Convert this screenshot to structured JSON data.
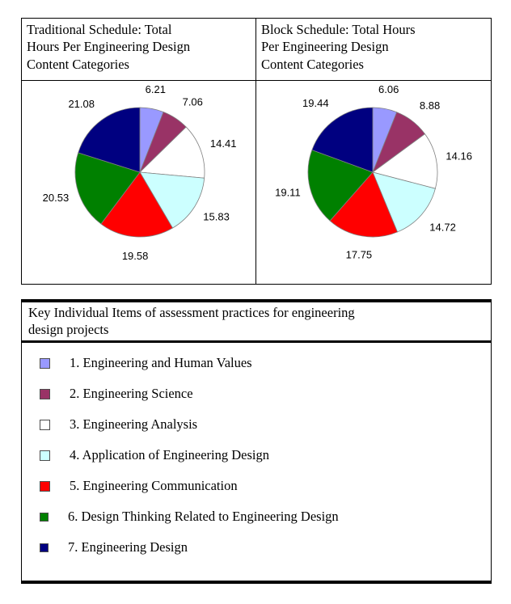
{
  "panels": [
    {
      "title_lines": [
        "Traditional Schedule: Total",
        "Hours Per Engineering Design",
        "Content Categories"
      ],
      "title_full": "Traditional Schedule: Total Hours Per Engineering Design Content Categories"
    },
    {
      "title_lines": [
        "Block Schedule: Total Hours",
        "Per Engineering Design",
        "Content Categories"
      ],
      "title_full": "Block Schedule: Total Hours Per Engineering Design Content Categories"
    }
  ],
  "legend": {
    "title_lines": [
      "Key Individual Items of assessment practices for engineering",
      "design projects"
    ],
    "title_full": "Key Individual Items of assessment practices for engineering design projects",
    "items": [
      {
        "label": "1. Engineering and Human Values",
        "color": "#9999FF"
      },
      {
        "label": "2. Engineering Science",
        "color": "#993366"
      },
      {
        "label": "3. Engineering Analysis",
        "color": "#FFFFFF"
      },
      {
        "label": "4. Application of Engineering Design",
        "color": "#CCFFFF"
      },
      {
        "label": "5. Engineering Communication",
        "color": "#FF0000"
      },
      {
        "label": "6. Design Thinking Related to Engineering Design",
        "color": "#008000"
      },
      {
        "label": "7. Engineering Design",
        "color": "#000080"
      }
    ]
  },
  "chart_data": [
    {
      "type": "pie",
      "title": "Traditional Schedule: Total Hours Per Engineering Design Content Categories",
      "categories": [
        "1. Engineering and Human Values",
        "2. Engineering Science",
        "3. Engineering Analysis",
        "4. Application of Engineering Design",
        "5. Engineering Communication",
        "6. Design Thinking Related to Engineering Design",
        "7. Engineering Design"
      ],
      "values": [
        6.21,
        7.06,
        14.41,
        15.83,
        19.58,
        20.53,
        21.08
      ],
      "labels": [
        "6.21",
        "7.06",
        "14.41",
        "15.83",
        "19.58",
        "20.53",
        "21.08"
      ],
      "colors": [
        "#9999FF",
        "#993366",
        "#FFFFFF",
        "#CCFFFF",
        "#FF0000",
        "#008000",
        "#000080"
      ],
      "start_angle_deg": 0,
      "direction": "clockwise",
      "legend_position": "below",
      "grid": false
    },
    {
      "type": "pie",
      "title": "Block Schedule: Total Hours Per Engineering Design Content Categories",
      "categories": [
        "1. Engineering and Human Values",
        "2. Engineering Science",
        "3. Engineering Analysis",
        "4. Application of Engineering Design",
        "5. Engineering Communication",
        "6. Design Thinking Related to Engineering Design",
        "7. Engineering Design"
      ],
      "values": [
        6.06,
        8.88,
        14.16,
        14.72,
        17.75,
        19.11,
        19.44
      ],
      "labels": [
        "6.06",
        "8.88",
        "14.16",
        "14.72",
        "17.75",
        "19.11",
        "19.44"
      ],
      "colors": [
        "#9999FF",
        "#993366",
        "#FFFFFF",
        "#CCFFFF",
        "#FF0000",
        "#008000",
        "#000080"
      ],
      "start_angle_deg": 0,
      "direction": "clockwise",
      "legend_position": "below",
      "grid": false
    }
  ]
}
